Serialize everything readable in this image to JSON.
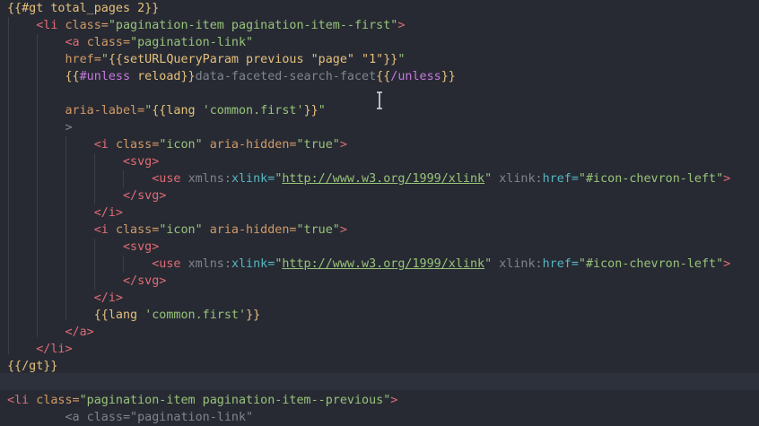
{
  "lines": [
    {
      "tokens": [
        [
          "{{#gt total_pages 2}}",
          "hb"
        ]
      ]
    },
    {
      "tokens": [
        [
          "    ",
          "plain"
        ],
        [
          "<li ",
          "tag"
        ],
        [
          "class=",
          "attr"
        ],
        [
          "\"pagination-item pagination-item--first\"",
          "str"
        ],
        [
          ">",
          "tag"
        ]
      ]
    },
    {
      "tokens": [
        [
          "        ",
          "plain"
        ],
        [
          "<a ",
          "tag"
        ],
        [
          "class=",
          "attr"
        ],
        [
          "\"pagination-link\"",
          "str"
        ]
      ]
    },
    {
      "tokens": [
        [
          "        ",
          "plain"
        ],
        [
          "href=",
          "attr"
        ],
        [
          "\"",
          "str"
        ],
        [
          "{{setURLQueryParam previous \"page\" \"1\"}}",
          "hb"
        ],
        [
          "\"",
          "str"
        ]
      ]
    },
    {
      "tokens": [
        [
          "        ",
          "plain"
        ],
        [
          "{{",
          "hb"
        ],
        [
          "#unless",
          "kw"
        ],
        [
          " reload}}",
          "hb"
        ],
        [
          "data-faceted-search-facet",
          "gray"
        ],
        [
          "{{",
          "hb"
        ],
        [
          "/unless",
          "kw"
        ],
        [
          "}}",
          "hb"
        ]
      ]
    },
    {
      "tokens": [
        [
          "",
          "plain"
        ]
      ]
    },
    {
      "tokens": [
        [
          "        ",
          "plain"
        ],
        [
          "aria-label=",
          "attr"
        ],
        [
          "\"",
          "str"
        ],
        [
          "{{lang ",
          "hb"
        ],
        [
          "'common.first'",
          "str"
        ],
        [
          "}}",
          "hb"
        ],
        [
          "\"",
          "str"
        ]
      ]
    },
    {
      "tokens": [
        [
          "        ",
          "plain"
        ],
        [
          ">",
          "gray"
        ]
      ]
    },
    {
      "tokens": [
        [
          "            ",
          "plain"
        ],
        [
          "<i ",
          "tag"
        ],
        [
          "class=",
          "attr"
        ],
        [
          "\"icon\" ",
          "str"
        ],
        [
          "aria-hidden=",
          "attr"
        ],
        [
          "\"true\"",
          "str"
        ],
        [
          ">",
          "tag"
        ]
      ]
    },
    {
      "tokens": [
        [
          "                ",
          "plain"
        ],
        [
          "<svg>",
          "tag"
        ]
      ]
    },
    {
      "tokens": [
        [
          "                    ",
          "plain"
        ],
        [
          "<use ",
          "tag"
        ],
        [
          "xmlns:",
          "gray"
        ],
        [
          "xlink=",
          "ns"
        ],
        [
          "\"",
          "str"
        ],
        [
          "http://www.w3.org/1999/xlink",
          "url"
        ],
        [
          "\" ",
          "str"
        ],
        [
          "xlink:",
          "gray"
        ],
        [
          "href=",
          "ns"
        ],
        [
          "\"#icon-chevron-left\"",
          "str"
        ],
        [
          ">",
          "tag"
        ]
      ]
    },
    {
      "tokens": [
        [
          "                ",
          "plain"
        ],
        [
          "</svg>",
          "tag"
        ]
      ]
    },
    {
      "tokens": [
        [
          "            ",
          "plain"
        ],
        [
          "</i>",
          "tag"
        ]
      ]
    },
    {
      "tokens": [
        [
          "            ",
          "plain"
        ],
        [
          "<i ",
          "tag"
        ],
        [
          "class=",
          "attr"
        ],
        [
          "\"icon\" ",
          "str"
        ],
        [
          "aria-hidden=",
          "attr"
        ],
        [
          "\"true\"",
          "str"
        ],
        [
          ">",
          "tag"
        ]
      ]
    },
    {
      "tokens": [
        [
          "                ",
          "plain"
        ],
        [
          "<svg>",
          "tag"
        ]
      ]
    },
    {
      "tokens": [
        [
          "                    ",
          "plain"
        ],
        [
          "<use ",
          "tag"
        ],
        [
          "xmlns:",
          "gray"
        ],
        [
          "xlink=",
          "ns"
        ],
        [
          "\"",
          "str"
        ],
        [
          "http://www.w3.org/1999/xlink",
          "url"
        ],
        [
          "\" ",
          "str"
        ],
        [
          "xlink:",
          "gray"
        ],
        [
          "href=",
          "ns"
        ],
        [
          "\"#icon-chevron-left\"",
          "str"
        ],
        [
          ">",
          "tag"
        ]
      ]
    },
    {
      "tokens": [
        [
          "                ",
          "plain"
        ],
        [
          "</svg>",
          "tag"
        ]
      ]
    },
    {
      "tokens": [
        [
          "            ",
          "plain"
        ],
        [
          "</i>",
          "tag"
        ]
      ]
    },
    {
      "tokens": [
        [
          "            ",
          "plain"
        ],
        [
          "{{lang ",
          "hb"
        ],
        [
          "'common.first'",
          "str"
        ],
        [
          "}}",
          "hb"
        ]
      ]
    },
    {
      "tokens": [
        [
          "        ",
          "plain"
        ],
        [
          "</a>",
          "tag"
        ]
      ]
    },
    {
      "tokens": [
        [
          "    ",
          "plain"
        ],
        [
          "</li>",
          "tag"
        ]
      ]
    },
    {
      "tokens": [
        [
          "{{/gt}}",
          "hb"
        ]
      ]
    },
    {
      "tokens": [
        [
          "",
          "plain"
        ]
      ]
    },
    {
      "tokens": [
        [
          "<li ",
          "tag"
        ],
        [
          "class=",
          "attr"
        ],
        [
          "\"pagination-item pagination-item--previous\"",
          "str"
        ],
        [
          ">",
          "tag"
        ]
      ]
    },
    {
      "tokens": [
        [
          "        ",
          "plain"
        ],
        [
          "<a class=\"pagination-link\"",
          "gray"
        ]
      ]
    }
  ],
  "colors": {
    "background": "#272a33",
    "current_line": "#2c313c",
    "indent_guide": "#3b4048"
  },
  "cursor_icon": "text-cursor-icon"
}
